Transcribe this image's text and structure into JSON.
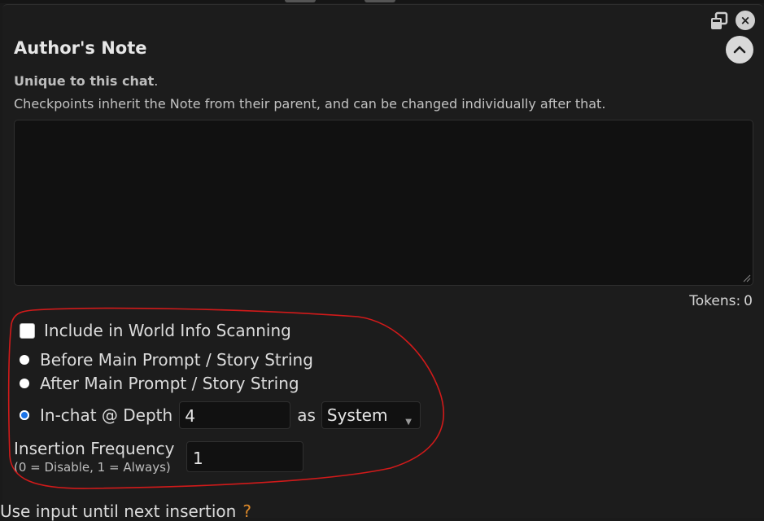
{
  "panel": {
    "title": "Author's Note",
    "unique_bold": "Unique to this chat",
    "unique_suffix": ".",
    "description": "Checkpoints inherit the Note from their parent, and can be changed individually after that.",
    "note_value": "",
    "tokens_label": "Tokens:",
    "tokens_value": "0"
  },
  "window_controls": {
    "detach_icon": "detach-icon",
    "close_icon": "close-icon",
    "close_glyph": "×",
    "collapse_icon": "chevron-up-icon"
  },
  "options": {
    "include_wi_label": "Include in World Info Scanning",
    "include_wi_checked": false,
    "before_label": "Before Main Prompt / Story String",
    "after_label": "After Main Prompt / Story String",
    "inchat_label": "In-chat @ Depth",
    "depth_value": "4",
    "as_label": "as",
    "role_value": "System",
    "selected_position": "In-chat @ Depth"
  },
  "frequency": {
    "label": "Insertion Frequency",
    "hint": "(0 = Disable, 1 = Always)",
    "value": "1"
  },
  "footer": {
    "cutoff_text": "Use input until next insertion",
    "help_icon": "help-icon"
  },
  "annotation": {
    "color": "#d11a1a"
  }
}
